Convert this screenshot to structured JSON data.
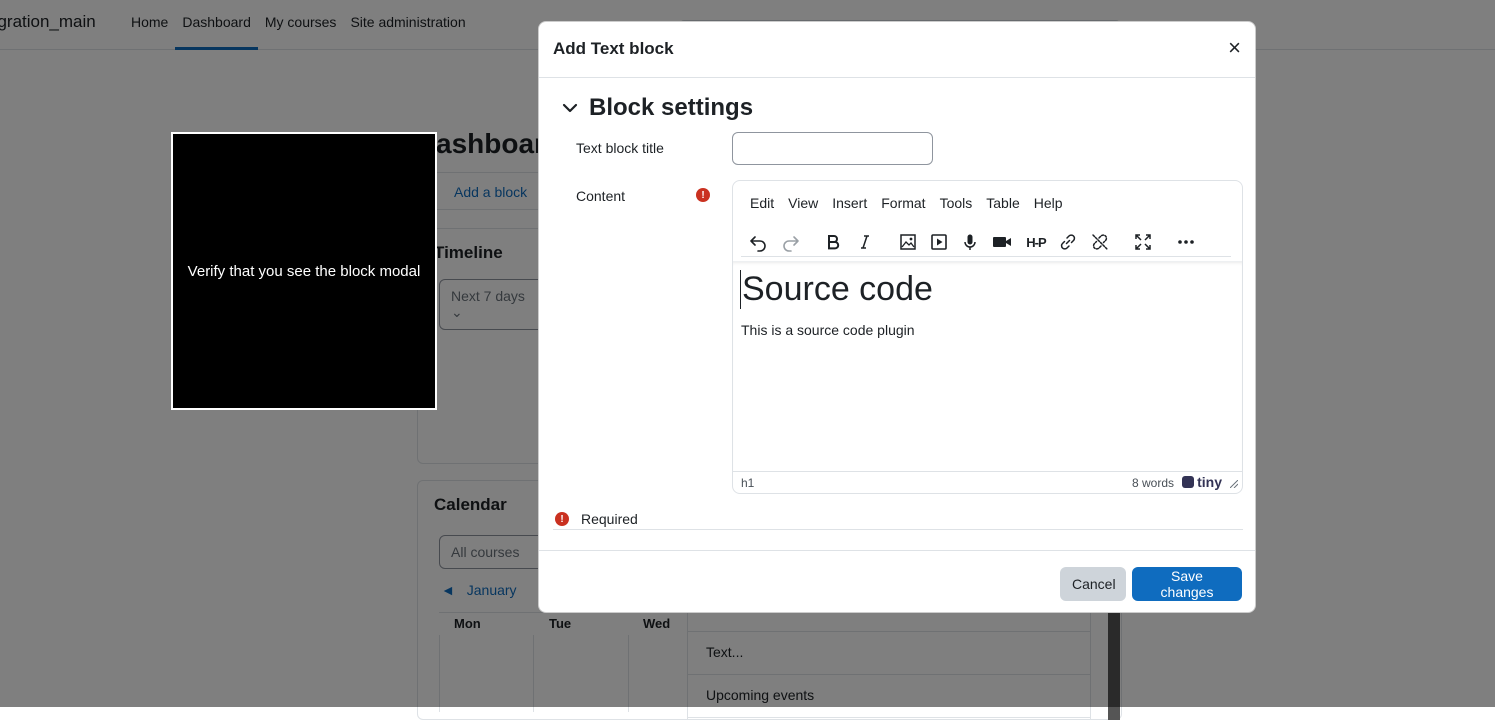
{
  "header": {
    "site_name": "egration_main",
    "nav": [
      {
        "label": "Home"
      },
      {
        "label": "Dashboard"
      },
      {
        "label": "My courses"
      },
      {
        "label": "Site administration"
      }
    ]
  },
  "page": {
    "title": "ashboar",
    "add_block": "Add a block",
    "timeline": {
      "title": "Timeline",
      "filter": "Next 7 days"
    },
    "calendar": {
      "title": "Calendar",
      "course_filter": "All courses",
      "month": "January",
      "month_prev_icon": "triangle-left-icon",
      "days": [
        "Mon",
        "Tue",
        "Wed"
      ]
    },
    "block_list": [
      "Text...",
      "Upcoming events"
    ]
  },
  "verify_overlay": {
    "text": "Verify that you see the block modal"
  },
  "modal": {
    "title": "Add Text block",
    "close_label": "×",
    "section_title": "Block settings",
    "fields": {
      "title_label": "Text block title",
      "title_value": "",
      "content_label": "Content"
    },
    "editor": {
      "menus": [
        "Edit",
        "View",
        "Insert",
        "Format",
        "Tools",
        "Table",
        "Help"
      ],
      "toolbar": [
        "undo-icon",
        "redo-icon",
        "bold-icon",
        "italic-icon",
        "image-icon",
        "media-icon",
        "microphone-icon",
        "video-camera-icon",
        "h5p-icon",
        "link-icon",
        "unlink-icon",
        "fullscreen-icon",
        "more-icon"
      ],
      "h5p_label": "H-P",
      "heading": "Source code",
      "paragraph": "This is a source code plugin",
      "status_path": "h1",
      "word_count": "8 words",
      "brand": "tiny"
    },
    "required_label": "Required",
    "required_icon": "!",
    "buttons": {
      "cancel": "Cancel",
      "save": "Save changes"
    },
    "colors": {
      "primary": "#0f6cbf",
      "danger": "#ca3120",
      "secondary": "#ced4da"
    }
  }
}
